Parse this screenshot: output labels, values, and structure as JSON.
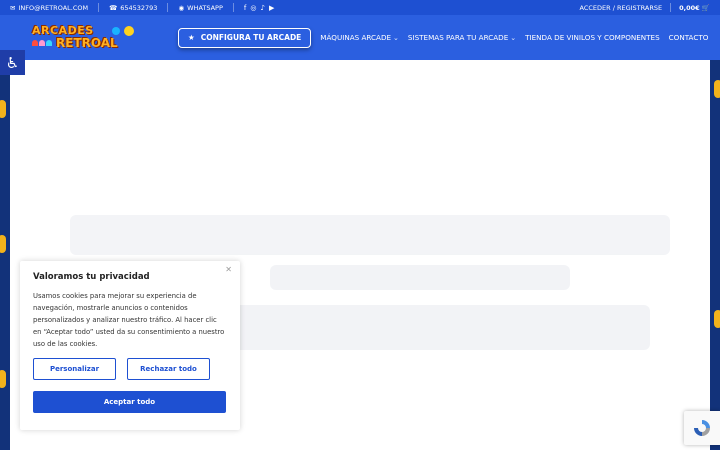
{
  "topbar": {
    "email": "INFO@RETROAL.COM",
    "phone": "654532793",
    "whatsapp": "WHATSAPP",
    "social_icons": [
      "facebook-icon",
      "instagram-icon",
      "tiktok-icon",
      "youtube-icon"
    ],
    "account": "ACCEDER / REGISTRARSE",
    "cart_total": "0,00€"
  },
  "header": {
    "logo_line1": "ARCADES",
    "logo_line2": "RETROAL",
    "cta_label": "CONFIGURA TU ARCADE",
    "nav": [
      {
        "label": "MÁQUINAS ARCADE",
        "has_dropdown": true
      },
      {
        "label": "SISTEMAS PARA TU ARCADE",
        "has_dropdown": true
      },
      {
        "label": "TIENDA DE VINILOS Y COMPONENTES",
        "has_dropdown": false
      },
      {
        "label": "CONTACTO",
        "has_dropdown": false
      }
    ]
  },
  "cookie": {
    "title": "Valoramos tu privacidad",
    "text": "Usamos cookies para mejorar su experiencia de navegación, mostrarle anuncios o contenidos personalizados y analizar nuestro tráfico. Al hacer clic en “Aceptar todo” usted da su consentimiento a nuestro uso de las cookies.",
    "customize": "Personalizar",
    "reject": "Rechazar todo",
    "accept": "Aceptar todo"
  },
  "colors": {
    "brand_blue": "#2b5fe0",
    "topbar_blue": "#1e50d2",
    "logo_orange": "#ffb020"
  }
}
